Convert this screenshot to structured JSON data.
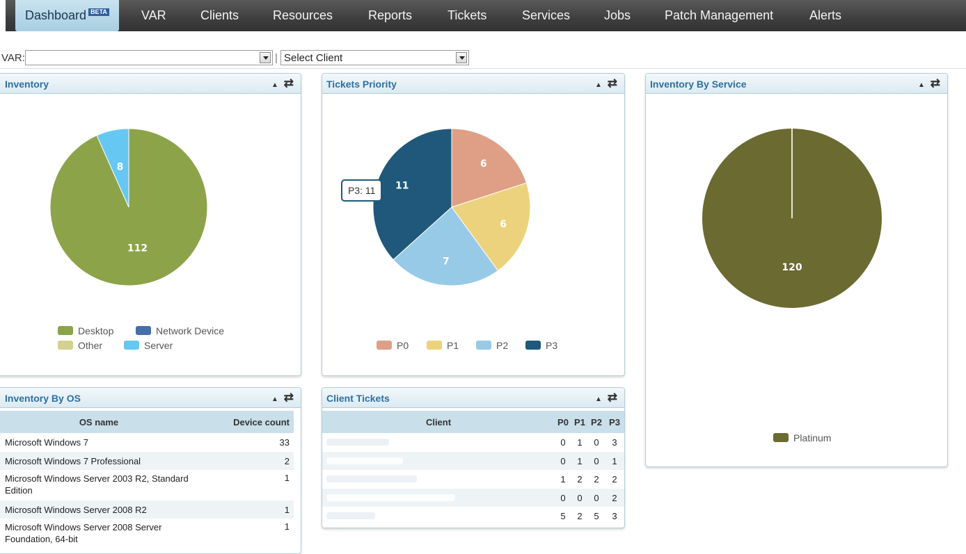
{
  "nav": {
    "items": [
      "Dashboard",
      "VAR",
      "Clients",
      "Resources",
      "Reports",
      "Tickets",
      "Services",
      "Jobs",
      "Patch Management",
      "Alerts"
    ],
    "beta": "BETA"
  },
  "filters": {
    "var_label": "VAR:",
    "var_value": "",
    "separator": "|",
    "client_value": "Select Client"
  },
  "inventory": {
    "title": "Inventory",
    "slices": [
      {
        "label": "Desktop",
        "value": 112,
        "color": "#8da34a"
      },
      {
        "label": "Server",
        "value": 8,
        "color": "#66c8f2"
      }
    ],
    "legend": [
      {
        "label": "Desktop",
        "color": "#8da34a"
      },
      {
        "label": "Network Device",
        "color": "#476ea6"
      },
      {
        "label": "Other",
        "color": "#d3d18f"
      },
      {
        "label": "Server",
        "color": "#66c8f2"
      }
    ]
  },
  "tickets_priority": {
    "title": "Tickets Priority",
    "tooltip": "P3: 11",
    "slices": [
      {
        "label": "P0",
        "value": 6,
        "color": "#de9f86"
      },
      {
        "label": "P1",
        "value": 6,
        "color": "#edd27e"
      },
      {
        "label": "P2",
        "value": 7,
        "color": "#97cae7"
      },
      {
        "label": "P3",
        "value": 11,
        "color": "#1f587a"
      }
    ]
  },
  "inventory_by_service": {
    "title": "Inventory By Service",
    "slices": [
      {
        "label": "Platinum",
        "value": 120,
        "color": "#6b6a31"
      }
    ]
  },
  "inventory_by_os": {
    "title": "Inventory By OS",
    "headers": [
      "OS name",
      "Device count"
    ],
    "rows": [
      {
        "name": "Microsoft Windows 7",
        "count": "33"
      },
      {
        "name": "Microsoft Windows 7 Professional",
        "count": "2"
      },
      {
        "name": "Microsoft Windows Server 2003 R2, Standard Edition",
        "count": "1"
      },
      {
        "name": "Microsoft Windows Server 2008 R2",
        "count": "1"
      },
      {
        "name": "Microsoft Windows Server 2008 Server Foundation, 64-bit",
        "count": "1"
      }
    ]
  },
  "client_tickets": {
    "title": "Client Tickets",
    "headers": [
      "Client",
      "P0",
      "P1",
      "P2",
      "P3"
    ],
    "rows": [
      {
        "p0": "0",
        "p1": "1",
        "p2": "0",
        "p3": "3"
      },
      {
        "p0": "0",
        "p1": "1",
        "p2": "0",
        "p3": "1"
      },
      {
        "p0": "1",
        "p1": "2",
        "p2": "2",
        "p3": "2"
      },
      {
        "p0": "0",
        "p1": "0",
        "p2": "0",
        "p3": "2"
      },
      {
        "p0": "5",
        "p1": "2",
        "p2": "5",
        "p3": "3"
      }
    ]
  },
  "tools": {
    "collapse": "▲",
    "refresh": "⇄"
  }
}
